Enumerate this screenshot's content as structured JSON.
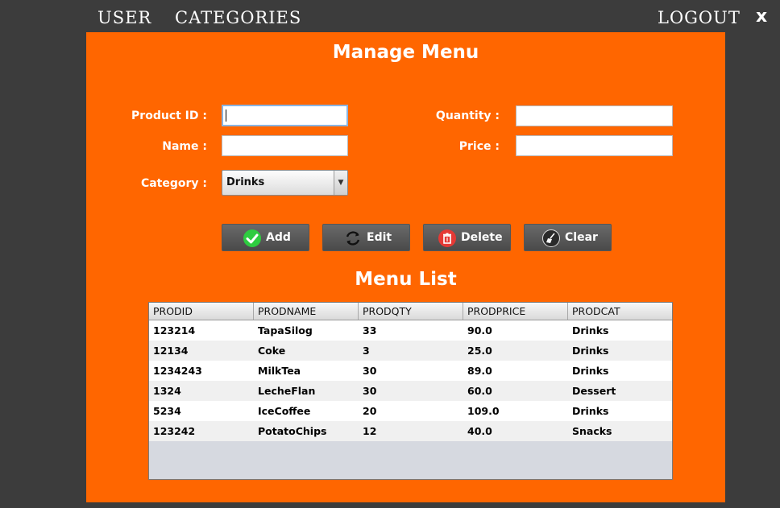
{
  "nav": {
    "user": "USER",
    "categories": "CATEGORIES",
    "logout": "LOGOUT",
    "close": "x"
  },
  "page_title": "Manage Menu",
  "form": {
    "product_id_label": "Product ID :",
    "name_label": "Name :",
    "category_label": "Category :",
    "quantity_label": "Quantity :",
    "price_label": "Price :",
    "product_id_value": "",
    "name_value": "",
    "quantity_value": "",
    "price_value": "",
    "category_selected": "Drinks"
  },
  "buttons": {
    "add": "Add",
    "edit": "Edit",
    "delete": "Delete",
    "clear": "Clear"
  },
  "list_title": "Menu List",
  "table": {
    "columns": [
      "PRODID",
      "PRODNAME",
      "PRODQTY",
      "PRODPRICE",
      "PRODCAT"
    ],
    "rows": [
      [
        "123214",
        "TapaSilog",
        "33",
        "90.0",
        "Drinks"
      ],
      [
        "12134",
        "Coke",
        "3",
        "25.0",
        "Drinks"
      ],
      [
        "1234243",
        "MilkTea",
        "30",
        "89.0",
        "Drinks"
      ],
      [
        "1324",
        "LecheFlan",
        "30",
        "60.0",
        "Dessert"
      ],
      [
        "5234",
        "IceCoffee",
        "20",
        "109.0",
        "Drinks"
      ],
      [
        "123242",
        "PotatoChips",
        "12",
        "40.0",
        "Snacks"
      ]
    ]
  },
  "colors": {
    "panel": "#ff6600",
    "background": "#3c3c3c",
    "button": "#5a5a5a",
    "add_icon": "#2ecc40",
    "delete_icon": "#e53935"
  },
  "icons": {
    "add": "check-icon",
    "edit": "refresh-icon",
    "delete": "trash-icon",
    "clear": "broom-icon"
  }
}
